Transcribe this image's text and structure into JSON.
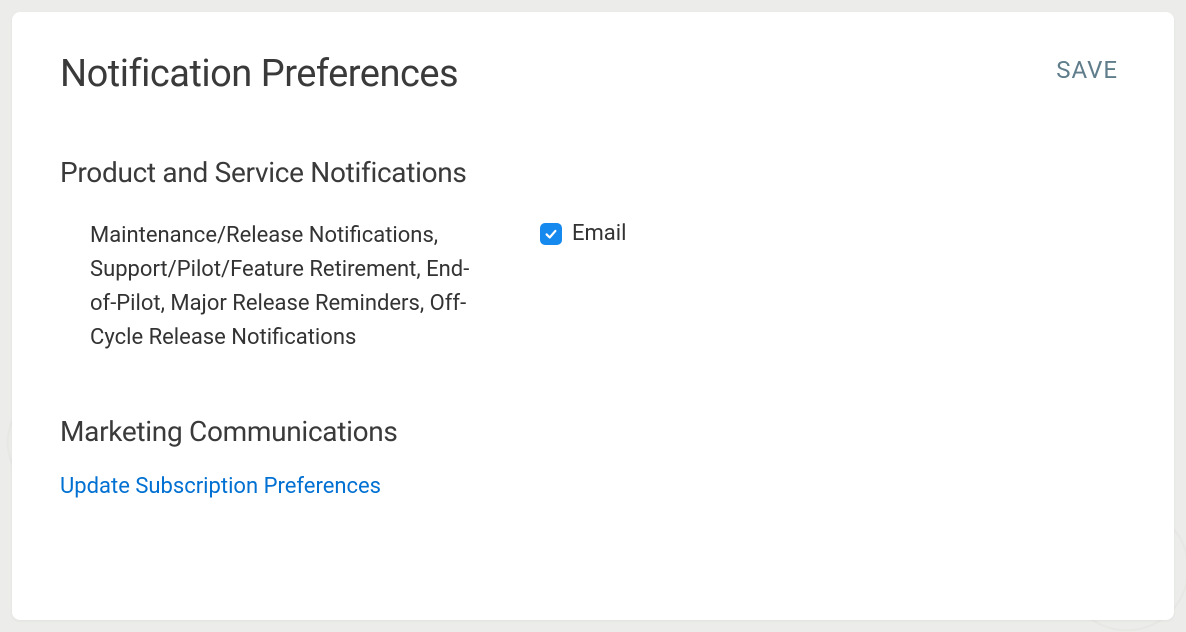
{
  "header": {
    "title": "Notification Preferences",
    "save_label": "SAVE"
  },
  "sections": {
    "product": {
      "heading": "Product and Service Notifications",
      "description": "Maintenance/Release Notifications, Support/Pilot/Feature Retirement, End-of-Pilot, Major Release Reminders, Off-Cycle Release Notifications",
      "email_checkbox": {
        "label": "Email",
        "checked": true
      }
    },
    "marketing": {
      "heading": "Marketing Communications",
      "link_label": "Update Subscription Preferences"
    }
  },
  "colors": {
    "link": "#0070d2",
    "checkbox": "#1589ee",
    "save": "#607d8b"
  }
}
